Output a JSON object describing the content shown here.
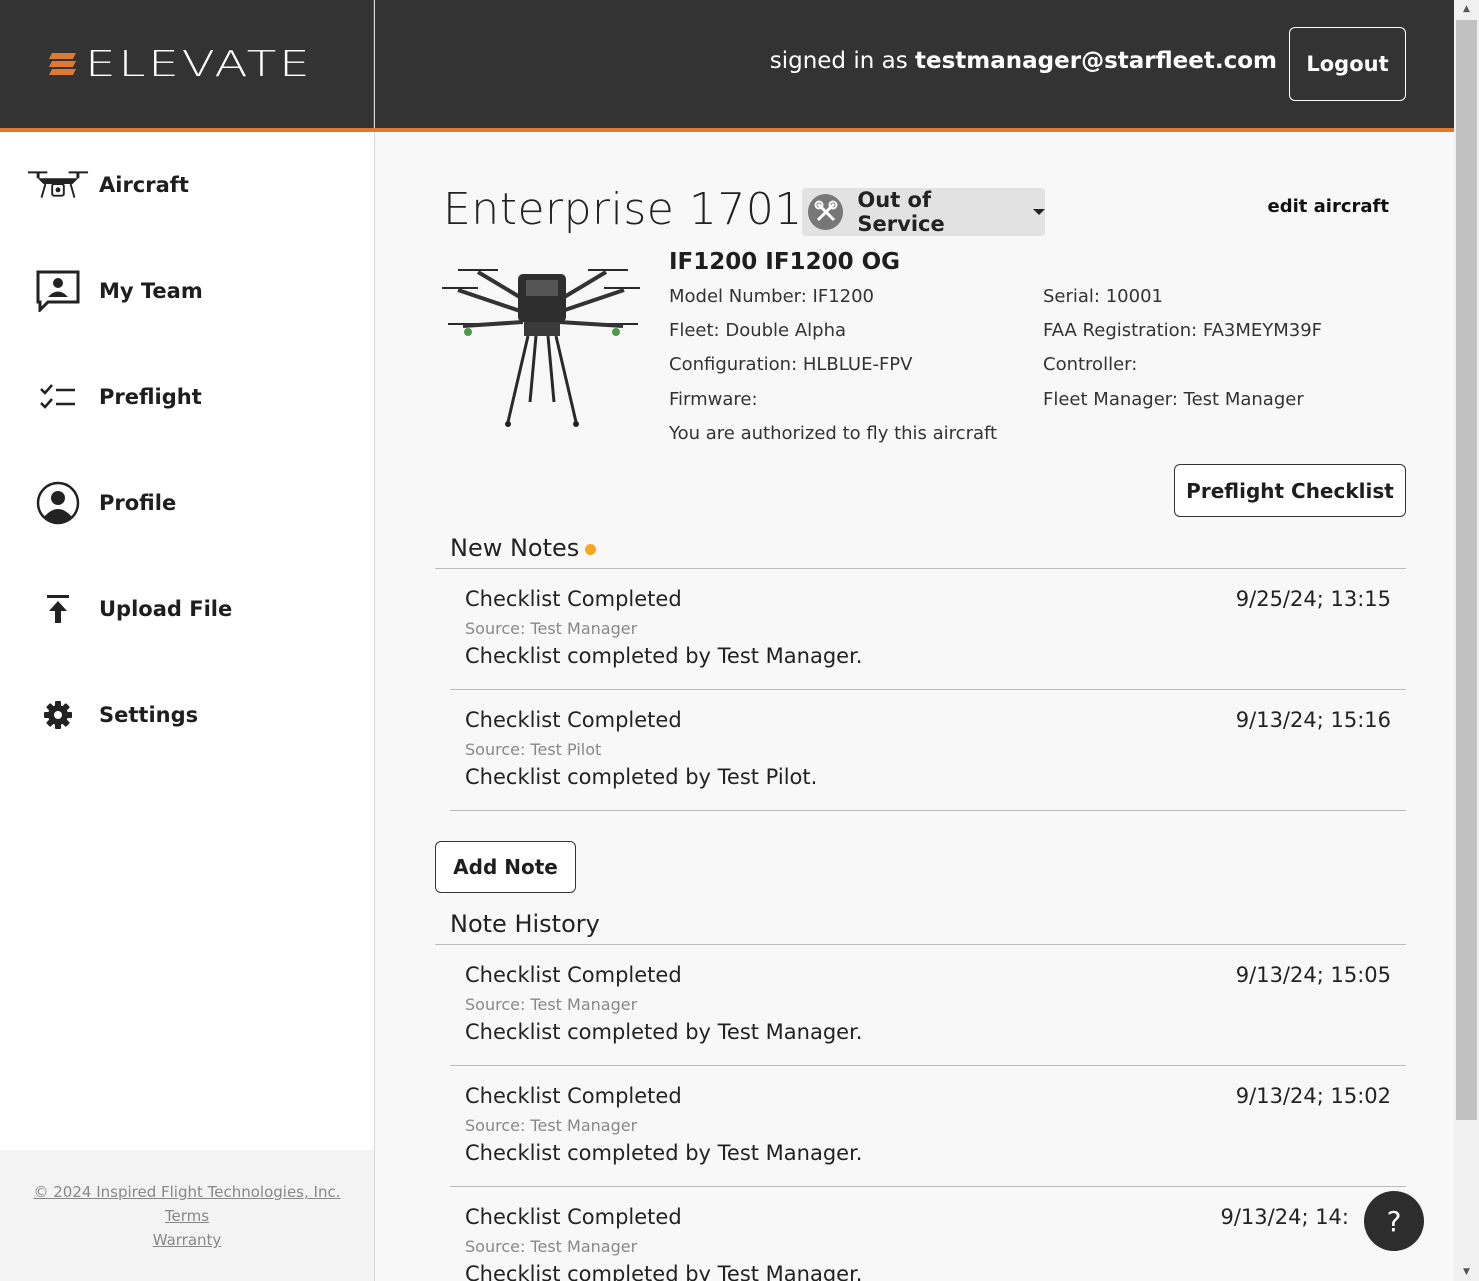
{
  "brand": {
    "name": "ELEVATE",
    "accent": "#e0782e"
  },
  "header": {
    "signed_prefix": "signed in as",
    "user_email": "testmanager@starfleet.com",
    "logout_label": "Logout"
  },
  "sidebar": {
    "items": [
      {
        "label": "Aircraft",
        "icon": "drone-icon"
      },
      {
        "label": "My Team",
        "icon": "team-chat-icon"
      },
      {
        "label": "Preflight",
        "icon": "checklist-icon"
      },
      {
        "label": "Profile",
        "icon": "user-circle-icon"
      },
      {
        "label": "Upload File",
        "icon": "upload-icon"
      },
      {
        "label": "Settings",
        "icon": "gear-icon"
      }
    ],
    "footer": {
      "copyright": "© 2024 Inspired Flight Technologies, Inc.",
      "terms": "Terms",
      "warranty": "Warranty"
    }
  },
  "aircraft": {
    "name": "Enterprise 1701",
    "status": "Out of Service",
    "edit_label": "edit aircraft",
    "model_title": "IF1200 IF1200 OG",
    "model_number": "Model Number: IF1200",
    "fleet": "Fleet: Double Alpha",
    "configuration": "Configuration: HLBLUE-FPV",
    "firmware": "Firmware:",
    "authorized": "You are authorized to fly this aircraft",
    "serial": "Serial: 10001",
    "faa": "FAA Registration: FA3MEYM39F",
    "controller": "Controller:",
    "fleet_manager": "Fleet Manager: Test Manager",
    "preflight_label": "Preflight Checklist"
  },
  "new_notes": {
    "heading": "New Notes",
    "items": [
      {
        "title": "Checklist Completed",
        "date": "9/25/24; 13:15",
        "source": "Source: Test Manager",
        "body": "Checklist completed by Test Manager."
      },
      {
        "title": "Checklist Completed",
        "date": "9/13/24; 15:16",
        "source": "Source: Test Pilot",
        "body": "Checklist completed by Test Pilot."
      }
    ]
  },
  "add_note_label": "Add Note",
  "note_history": {
    "heading": "Note History",
    "items": [
      {
        "title": "Checklist Completed",
        "date": "9/13/24; 15:05",
        "source": "Source: Test Manager",
        "body": "Checklist completed by Test Manager."
      },
      {
        "title": "Checklist Completed",
        "date": "9/13/24; 15:02",
        "source": "Source: Test Manager",
        "body": "Checklist completed by Test Manager."
      },
      {
        "title": "Checklist Completed",
        "date": "9/13/24; 14:",
        "source": "Source: Test Manager",
        "body": "Checklist completed by Test Manager."
      }
    ]
  },
  "help_label": "?"
}
